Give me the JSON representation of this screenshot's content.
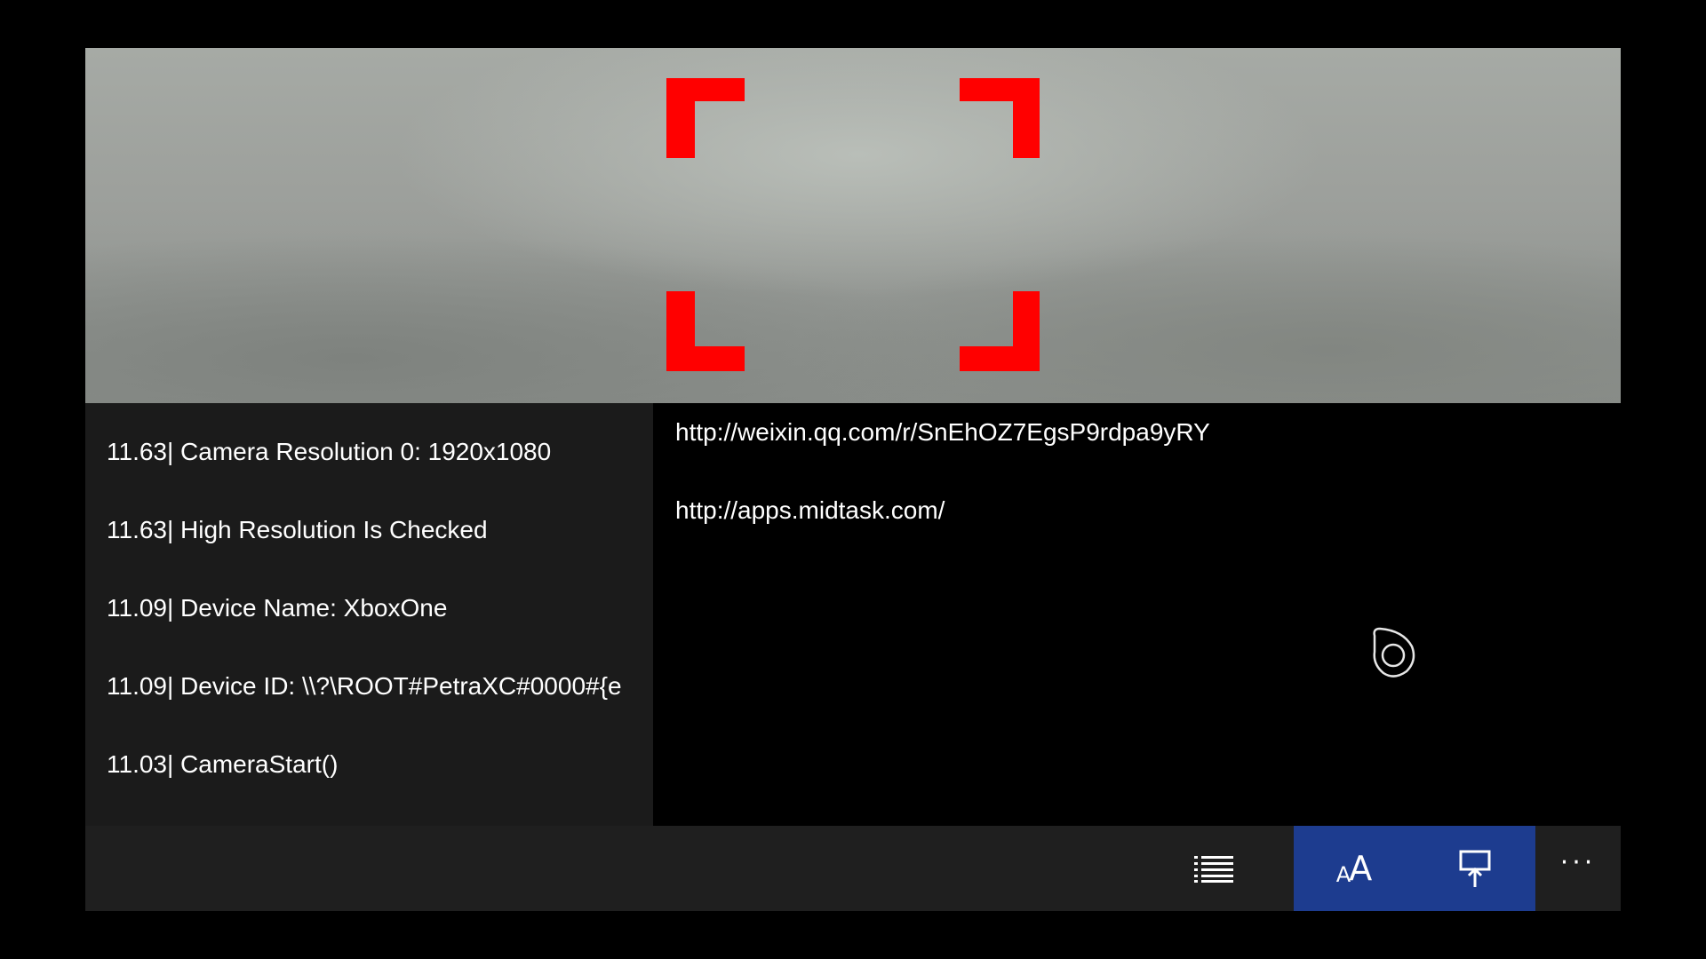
{
  "log": {
    "entries": [
      "11.63| Camera Resolution 0: 1920x1080",
      "11.63| High Resolution Is Checked",
      "11.09| Device Name: XboxOne",
      "11.09| Device ID: \\\\?\\ROOT#PetraXC#0000#{e",
      "11.03| CameraStart()"
    ]
  },
  "results": {
    "links": [
      "http://weixin.qq.com/r/SnEhOZ7EgsP9rdpa9yRY",
      "http://apps.midtask.com/"
    ]
  },
  "command_bar": {
    "list_icon": "list-icon",
    "font_size_icon": "font-size-icon",
    "font_size_label_small": "A",
    "font_size_label_big": "A",
    "pin_icon": "pin-to-screen-icon",
    "more_label": "···"
  },
  "colors": {
    "scan_frame": "#ff0000",
    "active_button": "#1d3c8f",
    "log_background": "#1b1b1b",
    "command_bar_background": "#1f1f1f"
  }
}
